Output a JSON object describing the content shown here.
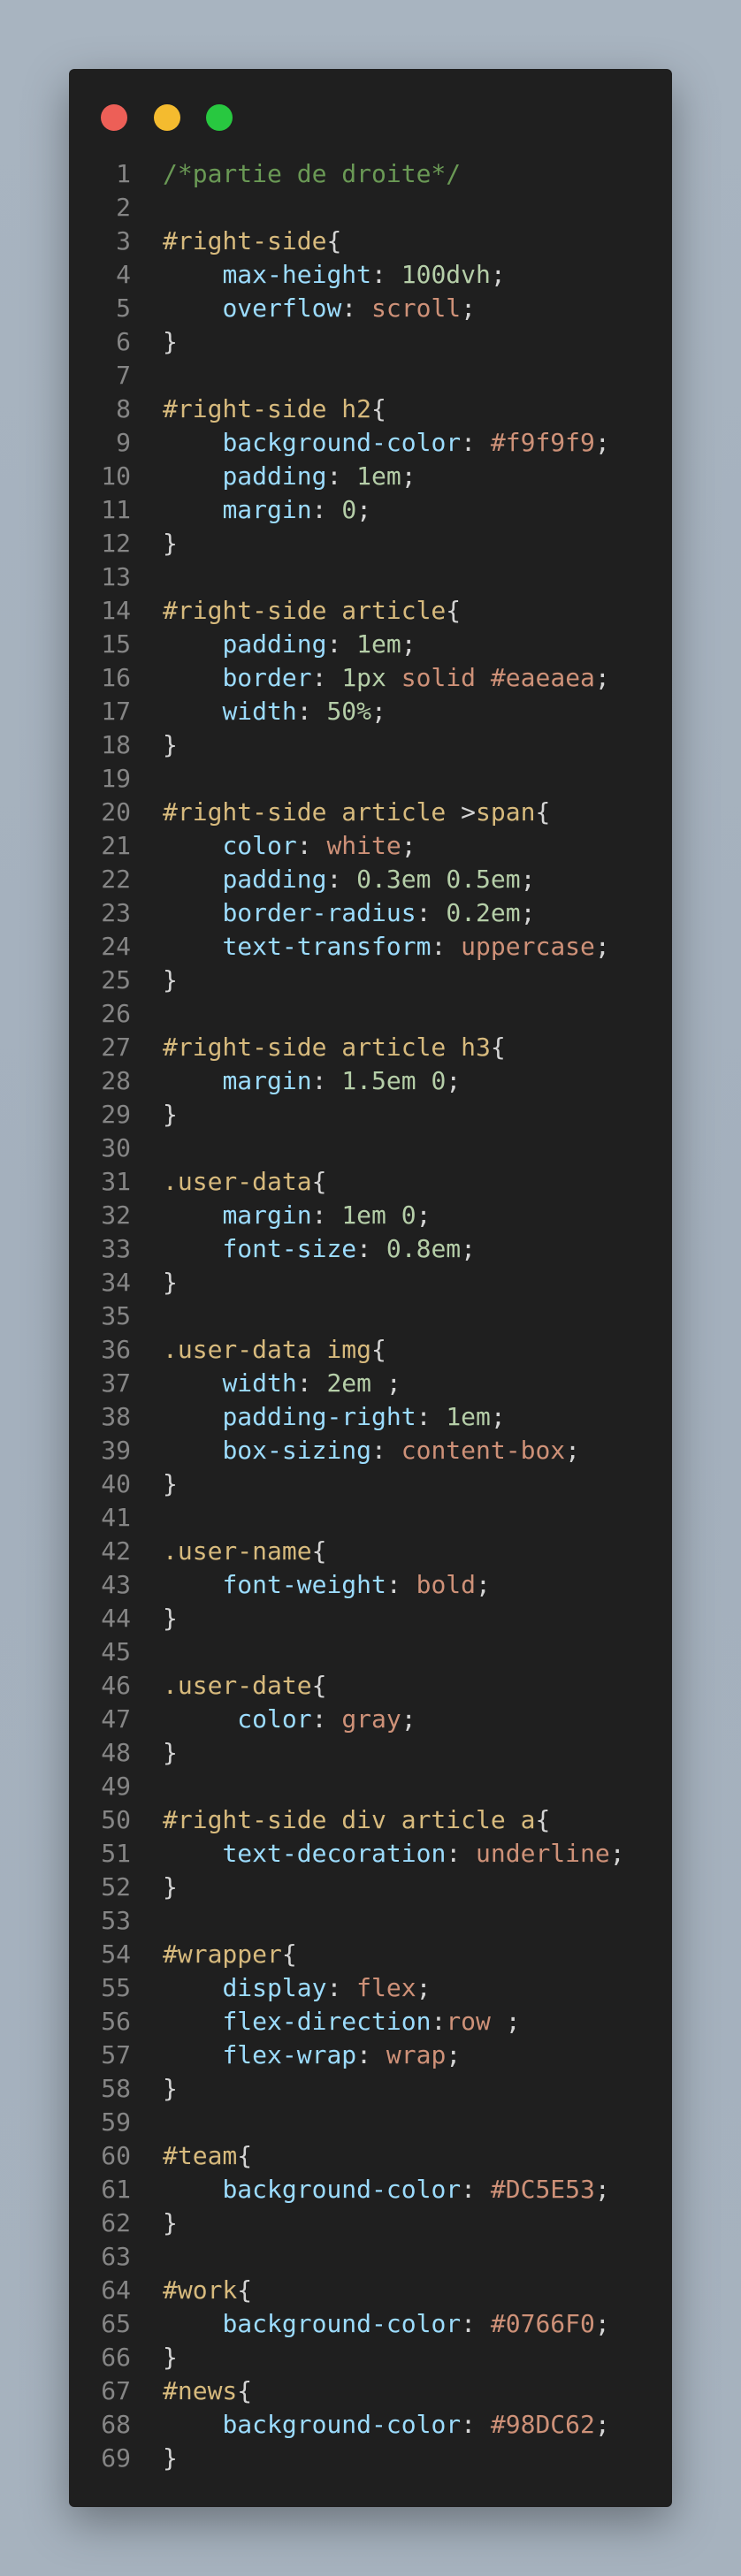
{
  "window": {
    "controls": [
      {
        "name": "close",
        "color": "#ed5f57"
      },
      {
        "name": "minimize",
        "color": "#f4bb2f"
      },
      {
        "name": "maximize",
        "color": "#28c840"
      }
    ]
  },
  "colors": {
    "comment": "#6a9955",
    "selector": "#d7ba7d",
    "property": "#9cdcfe",
    "number": "#b5cea8",
    "value": "#ce9178",
    "punct": "#d4d4d4",
    "line_number": "#858585"
  },
  "code": {
    "lines": [
      [
        [
          "cm",
          "/*partie de droite*/"
        ]
      ],
      [],
      [
        [
          "sel",
          "#right-side"
        ],
        [
          "p",
          "{"
        ]
      ],
      [
        [
          "p",
          "    "
        ],
        [
          "prop",
          "max-height"
        ],
        [
          "p",
          ": "
        ],
        [
          "num",
          "100dvh"
        ],
        [
          "p",
          ";"
        ]
      ],
      [
        [
          "p",
          "    "
        ],
        [
          "prop",
          "overflow"
        ],
        [
          "p",
          ": "
        ],
        [
          "val",
          "scroll"
        ],
        [
          "p",
          ";"
        ]
      ],
      [
        [
          "p",
          "}"
        ]
      ],
      [],
      [
        [
          "sel",
          "#right-side h2"
        ],
        [
          "p",
          "{"
        ]
      ],
      [
        [
          "p",
          "    "
        ],
        [
          "prop",
          "background-color"
        ],
        [
          "p",
          ": "
        ],
        [
          "val",
          "#f9f9f9"
        ],
        [
          "p",
          ";"
        ]
      ],
      [
        [
          "p",
          "    "
        ],
        [
          "prop",
          "padding"
        ],
        [
          "p",
          ": "
        ],
        [
          "num",
          "1em"
        ],
        [
          "p",
          ";"
        ]
      ],
      [
        [
          "p",
          "    "
        ],
        [
          "prop",
          "margin"
        ],
        [
          "p",
          ": "
        ],
        [
          "num",
          "0"
        ],
        [
          "p",
          ";"
        ]
      ],
      [
        [
          "p",
          "}"
        ]
      ],
      [],
      [
        [
          "sel",
          "#right-side article"
        ],
        [
          "p",
          "{"
        ]
      ],
      [
        [
          "p",
          "    "
        ],
        [
          "prop",
          "padding"
        ],
        [
          "p",
          ": "
        ],
        [
          "num",
          "1em"
        ],
        [
          "p",
          ";"
        ]
      ],
      [
        [
          "p",
          "    "
        ],
        [
          "prop",
          "border"
        ],
        [
          "p",
          ": "
        ],
        [
          "num",
          "1px"
        ],
        [
          "p",
          " "
        ],
        [
          "val",
          "solid"
        ],
        [
          "p",
          " "
        ],
        [
          "val",
          "#eaeaea"
        ],
        [
          "p",
          ";"
        ]
      ],
      [
        [
          "p",
          "    "
        ],
        [
          "prop",
          "width"
        ],
        [
          "p",
          ": "
        ],
        [
          "num",
          "50%"
        ],
        [
          "p",
          ";"
        ]
      ],
      [
        [
          "p",
          "}"
        ]
      ],
      [],
      [
        [
          "sel",
          "#right-side article "
        ],
        [
          "p",
          ">"
        ],
        [
          "sel",
          "span"
        ],
        [
          "p",
          "{"
        ]
      ],
      [
        [
          "p",
          "    "
        ],
        [
          "prop",
          "color"
        ],
        [
          "p",
          ": "
        ],
        [
          "val",
          "white"
        ],
        [
          "p",
          ";"
        ]
      ],
      [
        [
          "p",
          "    "
        ],
        [
          "prop",
          "padding"
        ],
        [
          "p",
          ": "
        ],
        [
          "num",
          "0.3em"
        ],
        [
          "p",
          " "
        ],
        [
          "num",
          "0.5em"
        ],
        [
          "p",
          ";"
        ]
      ],
      [
        [
          "p",
          "    "
        ],
        [
          "prop",
          "border-radius"
        ],
        [
          "p",
          ": "
        ],
        [
          "num",
          "0.2em"
        ],
        [
          "p",
          ";"
        ]
      ],
      [
        [
          "p",
          "    "
        ],
        [
          "prop",
          "text-transform"
        ],
        [
          "p",
          ": "
        ],
        [
          "val",
          "uppercase"
        ],
        [
          "p",
          ";"
        ]
      ],
      [
        [
          "p",
          "}"
        ]
      ],
      [],
      [
        [
          "sel",
          "#right-side article h3"
        ],
        [
          "p",
          "{"
        ]
      ],
      [
        [
          "p",
          "    "
        ],
        [
          "prop",
          "margin"
        ],
        [
          "p",
          ": "
        ],
        [
          "num",
          "1.5em"
        ],
        [
          "p",
          " "
        ],
        [
          "num",
          "0"
        ],
        [
          "p",
          ";"
        ]
      ],
      [
        [
          "p",
          "}"
        ]
      ],
      [],
      [
        [
          "sel",
          ".user-data"
        ],
        [
          "p",
          "{"
        ]
      ],
      [
        [
          "p",
          "    "
        ],
        [
          "prop",
          "margin"
        ],
        [
          "p",
          ": "
        ],
        [
          "num",
          "1em"
        ],
        [
          "p",
          " "
        ],
        [
          "num",
          "0"
        ],
        [
          "p",
          ";"
        ]
      ],
      [
        [
          "p",
          "    "
        ],
        [
          "prop",
          "font-size"
        ],
        [
          "p",
          ": "
        ],
        [
          "num",
          "0.8em"
        ],
        [
          "p",
          ";"
        ]
      ],
      [
        [
          "p",
          "}"
        ]
      ],
      [],
      [
        [
          "sel",
          ".user-data img"
        ],
        [
          "p",
          "{"
        ]
      ],
      [
        [
          "p",
          "    "
        ],
        [
          "prop",
          "width"
        ],
        [
          "p",
          ": "
        ],
        [
          "num",
          "2em"
        ],
        [
          "p",
          " ;"
        ]
      ],
      [
        [
          "p",
          "    "
        ],
        [
          "prop",
          "padding-right"
        ],
        [
          "p",
          ": "
        ],
        [
          "num",
          "1em"
        ],
        [
          "p",
          ";"
        ]
      ],
      [
        [
          "p",
          "    "
        ],
        [
          "prop",
          "box-sizing"
        ],
        [
          "p",
          ": "
        ],
        [
          "val",
          "content-box"
        ],
        [
          "p",
          ";"
        ]
      ],
      [
        [
          "p",
          "}"
        ]
      ],
      [],
      [
        [
          "sel",
          ".user-name"
        ],
        [
          "p",
          "{"
        ]
      ],
      [
        [
          "p",
          "    "
        ],
        [
          "prop",
          "font-weight"
        ],
        [
          "p",
          ": "
        ],
        [
          "val",
          "bold"
        ],
        [
          "p",
          ";"
        ]
      ],
      [
        [
          "p",
          "}"
        ]
      ],
      [],
      [
        [
          "sel",
          ".user-date"
        ],
        [
          "p",
          "{"
        ]
      ],
      [
        [
          "p",
          "     "
        ],
        [
          "prop",
          "color"
        ],
        [
          "p",
          ": "
        ],
        [
          "val",
          "gray"
        ],
        [
          "p",
          ";"
        ]
      ],
      [
        [
          "p",
          "}"
        ]
      ],
      [],
      [
        [
          "sel",
          "#right-side div article a"
        ],
        [
          "p",
          "{"
        ]
      ],
      [
        [
          "p",
          "    "
        ],
        [
          "prop",
          "text-decoration"
        ],
        [
          "p",
          ": "
        ],
        [
          "val",
          "underline"
        ],
        [
          "p",
          ";"
        ]
      ],
      [
        [
          "p",
          "}"
        ]
      ],
      [],
      [
        [
          "sel",
          "#wrapper"
        ],
        [
          "p",
          "{"
        ]
      ],
      [
        [
          "p",
          "    "
        ],
        [
          "prop",
          "display"
        ],
        [
          "p",
          ": "
        ],
        [
          "val",
          "flex"
        ],
        [
          "p",
          ";"
        ]
      ],
      [
        [
          "p",
          "    "
        ],
        [
          "prop",
          "flex-direction"
        ],
        [
          "p",
          ":"
        ],
        [
          "val",
          "row"
        ],
        [
          "p",
          " ;"
        ]
      ],
      [
        [
          "p",
          "    "
        ],
        [
          "prop",
          "flex-wrap"
        ],
        [
          "p",
          ": "
        ],
        [
          "val",
          "wrap"
        ],
        [
          "p",
          ";"
        ]
      ],
      [
        [
          "p",
          "}"
        ]
      ],
      [],
      [
        [
          "sel",
          "#team"
        ],
        [
          "p",
          "{"
        ]
      ],
      [
        [
          "p",
          "    "
        ],
        [
          "prop",
          "background-color"
        ],
        [
          "p",
          ": "
        ],
        [
          "val",
          "#DC5E53"
        ],
        [
          "p",
          ";"
        ]
      ],
      [
        [
          "p",
          "}"
        ]
      ],
      [],
      [
        [
          "sel",
          "#work"
        ],
        [
          "p",
          "{"
        ]
      ],
      [
        [
          "p",
          "    "
        ],
        [
          "prop",
          "background-color"
        ],
        [
          "p",
          ": "
        ],
        [
          "val",
          "#0766F0"
        ],
        [
          "p",
          ";"
        ]
      ],
      [
        [
          "p",
          "}"
        ]
      ],
      [
        [
          "sel",
          "#news"
        ],
        [
          "p",
          "{"
        ]
      ],
      [
        [
          "p",
          "    "
        ],
        [
          "prop",
          "background-color"
        ],
        [
          "p",
          ": "
        ],
        [
          "val",
          "#98DC62"
        ],
        [
          "p",
          ";"
        ]
      ],
      [
        [
          "p",
          "}"
        ]
      ]
    ]
  }
}
